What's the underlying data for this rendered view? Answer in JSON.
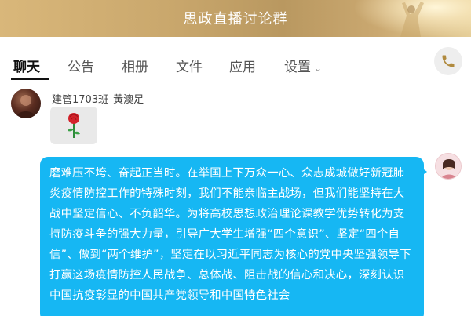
{
  "banner": {
    "title": "思政直播讨论群"
  },
  "tabs": [
    {
      "label": "聊天",
      "active": true
    },
    {
      "label": "公告"
    },
    {
      "label": "相册"
    },
    {
      "label": "文件"
    },
    {
      "label": "应用"
    },
    {
      "label": "设置"
    }
  ],
  "header": {
    "phone_icon": "phone-icon"
  },
  "messages": [
    {
      "sender_class": "建管1703班",
      "sender_name": "黃澳足",
      "content_type": "sticker",
      "sticker": "rose-icon"
    },
    {
      "content_type": "text",
      "from_self": true,
      "text": "磨难压不垮、奋起正当时。在举国上下万众一心、众志成城做好新冠肺炎疫情防控工作的特殊时刻，我们不能亲临主战场，但我们能坚持在大战中坚定信心、不负韶华。为将高校思想政治理论课教学优势转化为支持防疫斗争的强大力量，引导广大学生增强“四个意识”、坚定“四个自信”、做到“两个维护”，坚定在以习近平同志为核心的党中央坚强领导下打赢这场疫情防控人民战争、总体战、阻击战的信心和决心，深刻认识中国抗疫彰显的中国共产党领导和中国特色社会"
    }
  ],
  "colors": {
    "bubble": "#16b7f3",
    "banner": "#c9a86c"
  }
}
